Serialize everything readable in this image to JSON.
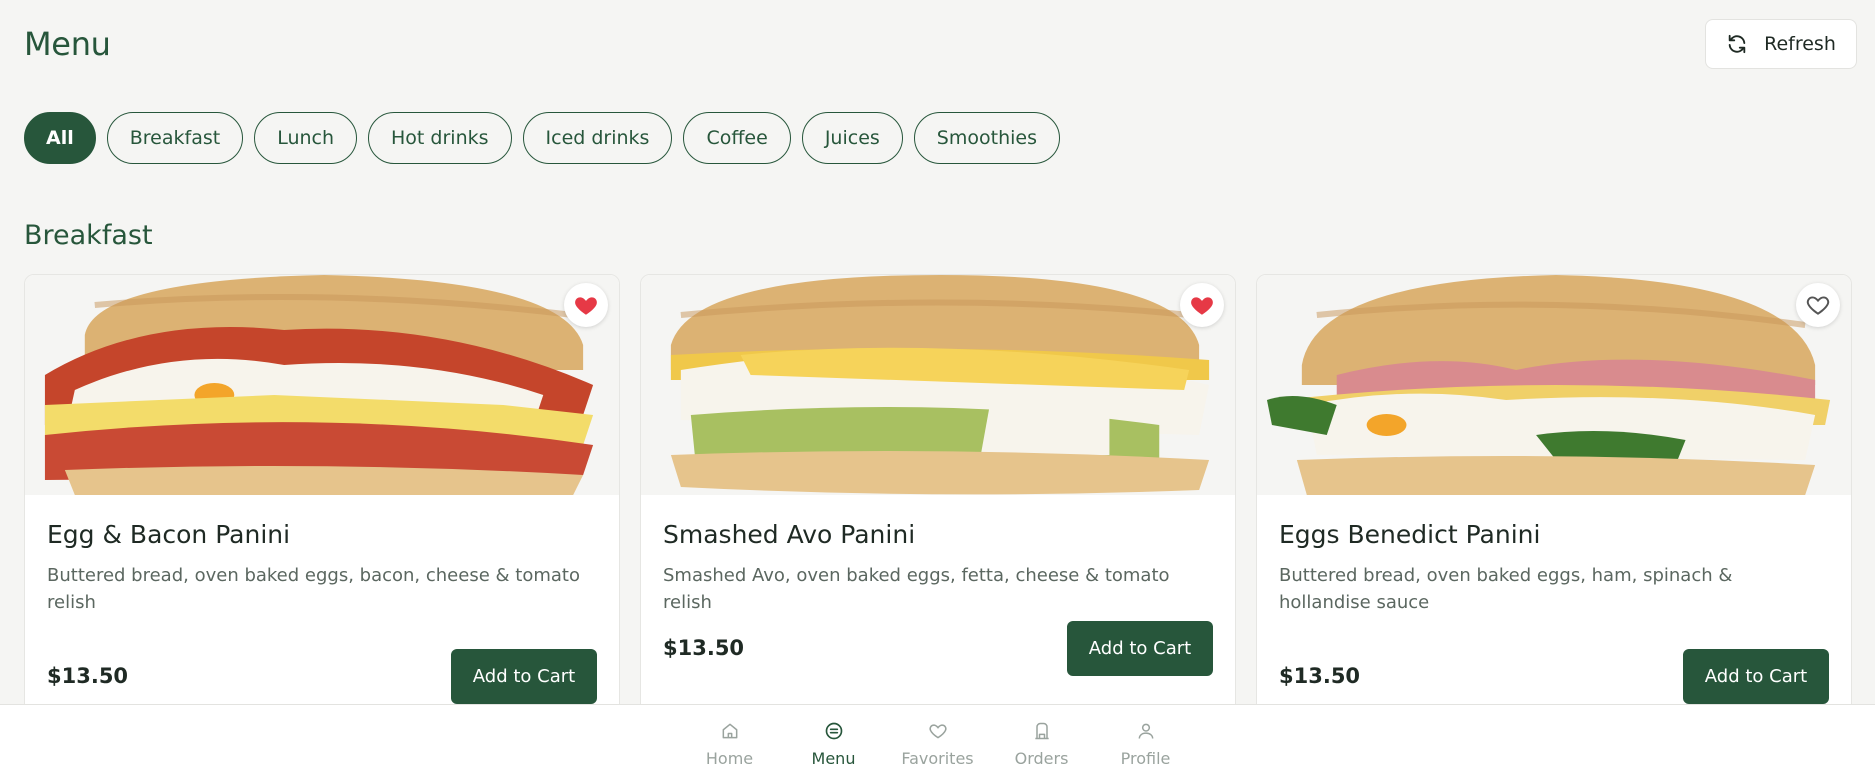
{
  "header": {
    "title": "Menu",
    "refresh_label": "Refresh"
  },
  "categories": [
    {
      "label": "All",
      "active": true
    },
    {
      "label": "Breakfast",
      "active": false
    },
    {
      "label": "Lunch",
      "active": false
    },
    {
      "label": "Hot drinks",
      "active": false
    },
    {
      "label": "Iced drinks",
      "active": false
    },
    {
      "label": "Coffee",
      "active": false
    },
    {
      "label": "Juices",
      "active": false
    },
    {
      "label": "Smoothies",
      "active": false
    }
  ],
  "section": {
    "title": "Breakfast"
  },
  "items": [
    {
      "name": "Egg & Bacon Panini",
      "description": "Buttered bread, oven baked eggs, bacon, cheese & tomato relish",
      "price": "$13.50",
      "button_label": "Add to Cart",
      "favorite": true,
      "image_icon": "panini-egg-bacon-image"
    },
    {
      "name": "Smashed Avo Panini",
      "description": "Smashed Avo, oven baked eggs, fetta, cheese & tomato relish",
      "price": "$13.50",
      "button_label": "Add to Cart",
      "favorite": true,
      "image_icon": "panini-smashed-avo-image"
    },
    {
      "name": "Eggs Benedict Panini",
      "description": "Buttered bread, oven baked eggs, ham, spinach & hollandise sauce",
      "price": "$13.50",
      "button_label": "Add to Cart",
      "favorite": false,
      "image_icon": "panini-eggs-benedict-image"
    }
  ],
  "bottom_nav": [
    {
      "label": "Home",
      "icon": "home-icon",
      "active": false
    },
    {
      "label": "Menu",
      "icon": "menu-icon",
      "active": true
    },
    {
      "label": "Favorites",
      "icon": "heart-icon",
      "active": false
    },
    {
      "label": "Orders",
      "icon": "orders-icon",
      "active": false
    },
    {
      "label": "Profile",
      "icon": "profile-icon",
      "active": false
    }
  ],
  "colors": {
    "brand": "#27563b",
    "favorite": "#e63946",
    "background": "#f5f5f3"
  }
}
